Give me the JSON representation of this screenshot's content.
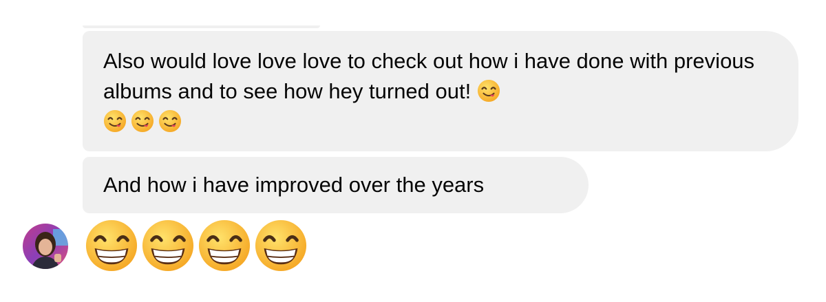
{
  "conversation": {
    "messages": [
      {
        "text": "Also would love love love to check out how i have done with previous albums and to see how hey turned out!",
        "emoji": [
          "face-savoring-food",
          "face-savoring-food",
          "face-savoring-food",
          "face-savoring-food"
        ]
      },
      {
        "text": "And how i have improved over the years"
      },
      {
        "emoji_only": [
          "beaming-face-with-smiling-eyes",
          "beaming-face-with-smiling-eyes",
          "beaming-face-with-smiling-eyes",
          "beaming-face-with-smiling-eyes"
        ]
      }
    ],
    "sender_avatar": "user-avatar-photo",
    "colors": {
      "bubble_bg": "#f0f0f0",
      "text": "#050505",
      "emoji_yellow": "#ffc83d"
    }
  }
}
